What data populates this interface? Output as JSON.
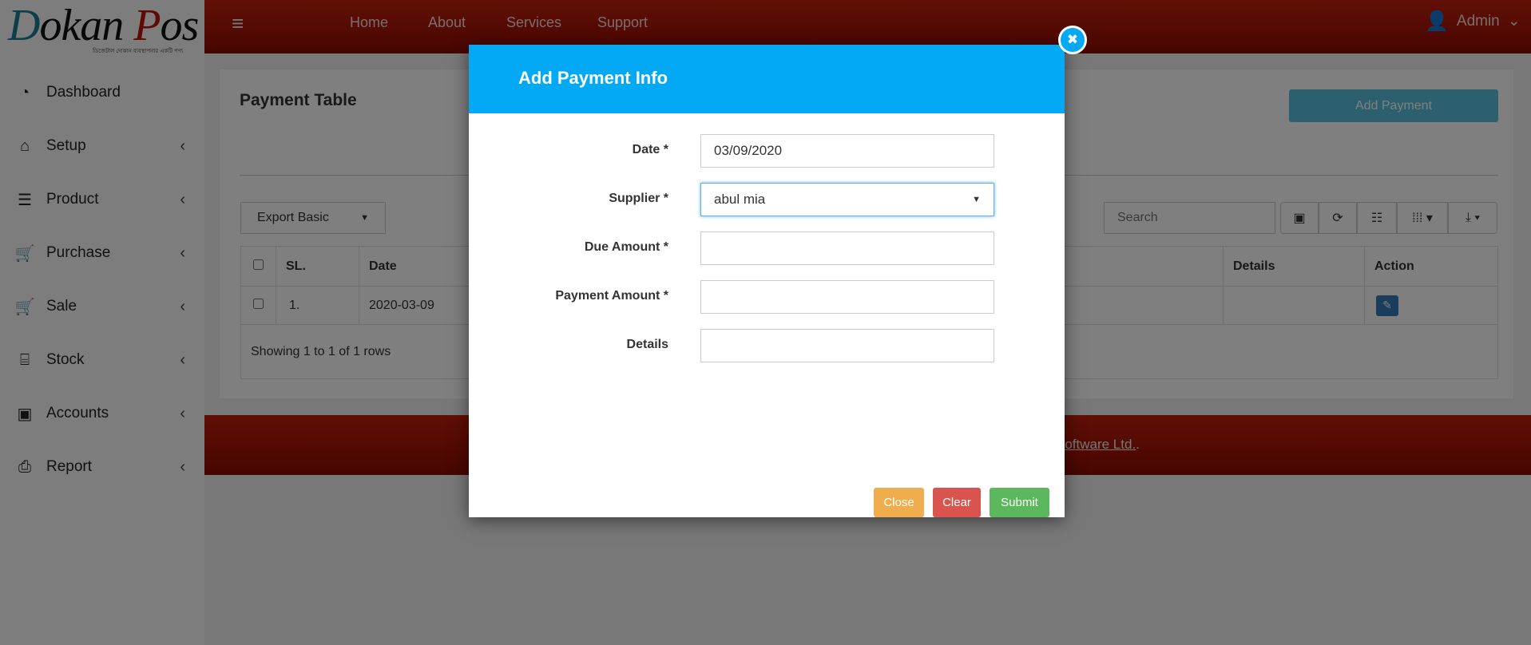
{
  "logo": {
    "text_a": "D",
    "text_b": "okan ",
    "text_c": "P",
    "text_d": "os",
    "tagline": "ডিজেটাল দোকান ব্যবস্থাপনার একটি পণ্য"
  },
  "sidebar": {
    "items": [
      {
        "label": "Dashboard",
        "icon": "dashboard-icon",
        "glyph": "◔",
        "chev": false
      },
      {
        "label": "Setup",
        "icon": "home-icon",
        "glyph": "⌂",
        "chev": true
      },
      {
        "label": "Product",
        "icon": "server-icon",
        "glyph": "☰",
        "chev": true
      },
      {
        "label": "Purchase",
        "icon": "cart-plus-icon",
        "glyph": "🛒",
        "chev": true
      },
      {
        "label": "Sale",
        "icon": "cart-icon",
        "glyph": "🛒",
        "chev": true
      },
      {
        "label": "Stock",
        "icon": "basket-icon",
        "glyph": "⌸",
        "chev": true
      },
      {
        "label": "Accounts",
        "icon": "money-icon",
        "glyph": "▣",
        "chev": true
      },
      {
        "label": "Report",
        "icon": "print-icon",
        "glyph": "⎙",
        "chev": true
      }
    ]
  },
  "header": {
    "menu": "≡",
    "nav": [
      "Home",
      "About",
      "Services",
      "Support"
    ],
    "user": "Admin",
    "caret": "⌄"
  },
  "page": {
    "title": "Payment Table",
    "add_button": "Add Payment",
    "export": "Export Basic",
    "search_placeholder": "Search",
    "columns": [
      "SL.",
      "Date",
      "Details",
      "Action"
    ],
    "rows": [
      {
        "sl": "1.",
        "date": "2020-03-09",
        "details": ""
      }
    ],
    "pagination": "Showing 1 to 1 of 1 rows"
  },
  "footer": {
    "link": "Software Ltd.",
    "dot": "."
  },
  "modal": {
    "title": "Add Payment Info",
    "close_glyph": "✖",
    "fields": [
      {
        "label": "Date *",
        "value": "03/09/2020"
      },
      {
        "label": "Supplier *",
        "value": "abul mia"
      },
      {
        "label": "Due Amount *",
        "value": ""
      },
      {
        "label": "Payment Amount *",
        "value": ""
      },
      {
        "label": "Details",
        "value": ""
      }
    ],
    "buttons": {
      "close": "Close",
      "clear": "Clear",
      "submit": "Submit"
    }
  },
  "colors": {
    "header": "#a8150a",
    "modal_head": "#03a9f4",
    "close": "#f0ad4e",
    "clear": "#d9534f",
    "submit": "#5cb85c",
    "edit": "#337ab7"
  }
}
